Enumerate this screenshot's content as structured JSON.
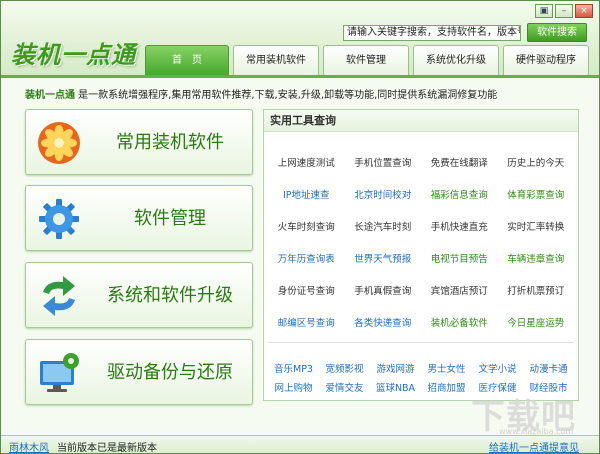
{
  "app": {
    "logo_text": "装机一点通",
    "window_buttons": {
      "settings": "▣",
      "minimize": "–",
      "close": "×"
    }
  },
  "search": {
    "value": "请输入关键字搜索，支持软件名，版本号",
    "button_label": "软件搜索"
  },
  "tabs": [
    {
      "label": "首　页",
      "active": true
    },
    {
      "label": "常用装机软件",
      "active": false
    },
    {
      "label": "软件管理",
      "active": false
    },
    {
      "label": "系统优化升级",
      "active": false
    },
    {
      "label": "硬件驱动程序",
      "active": false
    }
  ],
  "description": {
    "name": "装机一点通",
    "text": " 是一款系统增强程序,集用常用软件推荐,下载,安装,升级,卸载等功能,同时提供系统漏洞修复功能"
  },
  "big_buttons": [
    {
      "label": "常用装机软件",
      "icon": "flower-icon"
    },
    {
      "label": "软件管理",
      "icon": "gear-icon"
    },
    {
      "label": "系统和软件升级",
      "icon": "refresh-arrows-icon"
    },
    {
      "label": "驱动备份与还原",
      "icon": "monitor-gear-icon"
    }
  ],
  "tools_panel": {
    "title": "实用工具查询",
    "rows": [
      [
        {
          "t": "上网速度测试",
          "c": "gray"
        },
        {
          "t": "手机位置查询",
          "c": "gray"
        },
        {
          "t": "免费在线翻译",
          "c": "gray"
        },
        {
          "t": "历史上的今天",
          "c": "gray"
        }
      ],
      [
        {
          "t": "IP地址速查",
          "c": "blue"
        },
        {
          "t": "北京时间校对",
          "c": "blue"
        },
        {
          "t": "福彩信息查询",
          "c": "green"
        },
        {
          "t": "体育彩票查询",
          "c": "green"
        }
      ],
      [
        {
          "t": "火车时刻查询",
          "c": "gray"
        },
        {
          "t": "长途汽车时刻",
          "c": "gray"
        },
        {
          "t": "手机快速直充",
          "c": "gray"
        },
        {
          "t": "实时汇率转换",
          "c": "gray"
        }
      ],
      [
        {
          "t": "万年历查询表",
          "c": "blue"
        },
        {
          "t": "世界天气预报",
          "c": "blue"
        },
        {
          "t": "电视节目预告",
          "c": "green"
        },
        {
          "t": "车辆违章查询",
          "c": "green"
        }
      ],
      [
        {
          "t": "身份证号查询",
          "c": "gray"
        },
        {
          "t": "手机真假查询",
          "c": "gray"
        },
        {
          "t": "宾馆酒店预订",
          "c": "gray"
        },
        {
          "t": "打折机票预订",
          "c": "gray"
        }
      ],
      [
        {
          "t": "邮编区号查询",
          "c": "blue"
        },
        {
          "t": "各类快递查询",
          "c": "blue"
        },
        {
          "t": "装机必备软件",
          "c": "green"
        },
        {
          "t": "今日星座运势",
          "c": "green"
        }
      ]
    ],
    "links": [
      [
        "音乐MP3",
        "宽频影视",
        "游戏网游",
        "男士女性",
        "文学小说",
        "动漫卡通"
      ],
      [
        "网上购物",
        "爱情交友",
        "篮球NBA",
        "招商加盟",
        "医疗保健",
        "财经股市"
      ]
    ]
  },
  "status": {
    "author": "雨林木风",
    "message": "当前版本已是最新版本",
    "right_link": "给装机一点通提意见"
  },
  "watermark": {
    "text": "下载吧",
    "url": "www.xiazaiba.com"
  }
}
